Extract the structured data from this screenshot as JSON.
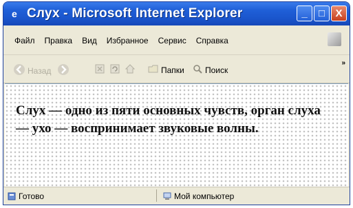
{
  "window": {
    "title": "Слух - Microsoft Internet Explorer",
    "buttons": {
      "minimize": "_",
      "maximize": "□",
      "close": "X"
    }
  },
  "menubar": {
    "items": [
      {
        "label": "Файл"
      },
      {
        "label": "Правка"
      },
      {
        "label": "Вид"
      },
      {
        "label": "Избранное"
      },
      {
        "label": "Сервис"
      },
      {
        "label": "Справка"
      }
    ]
  },
  "toolbar": {
    "back_label": "Назад",
    "folders_label": "Папки",
    "search_label": "Поиск",
    "more_chevron": "»"
  },
  "content": {
    "text": "Слух — одно из пяти основных чувств, орган слуха — ухо — воспринимает звуковые волны."
  },
  "statusbar": {
    "status": "Готово",
    "zone": "Мой компьютер"
  },
  "colors": {
    "titlebar": "#1f5fd8",
    "chrome": "#ece9d8",
    "close_button": "#c8401f"
  }
}
